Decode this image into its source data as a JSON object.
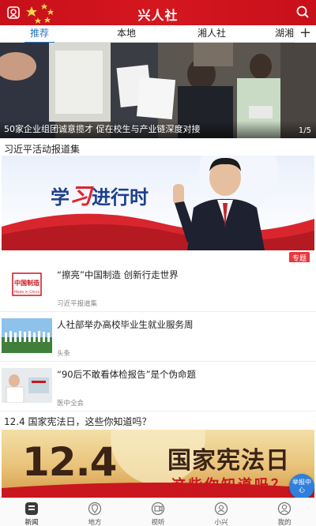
{
  "header": {
    "title": "兴人社"
  },
  "tabs": [
    {
      "label": "推荐",
      "active": true
    },
    {
      "label": "本地"
    },
    {
      "label": "湘人社"
    },
    {
      "label": "湖湘"
    }
  ],
  "tab_add_label": "+",
  "hero": {
    "caption": "50家企业组团诚意揽才 促在校生与产业链深度对接",
    "counter": "1/5"
  },
  "section1": {
    "title": "习近平活动报道集"
  },
  "banner1": {
    "text_study": "学",
    "text_xi": "习",
    "text_rest": "进行时",
    "tag": "专题"
  },
  "news": [
    {
      "title": "“擦亮”中国制造 创新行走世界",
      "source": "习近平报道集",
      "thumb_text": "中国制造",
      "thumb_sub": "Made in China"
    },
    {
      "title": "人社部举办高校毕业生就业服务周",
      "source": "头条"
    },
    {
      "title": "“90后不敢看体检报告”是个伪命题",
      "source": "医中全会"
    }
  ],
  "section2": {
    "title": "12.4  国家宪法日，这些你知道吗？"
  },
  "banner2": {
    "date": "12.4",
    "line1": "国家宪法日",
    "line2": "这些你知道吗？"
  },
  "report_fab": {
    "line1": "举报中",
    "line2": "心"
  },
  "bottom_nav": [
    {
      "label": "新闻",
      "icon": "news-icon",
      "active": true
    },
    {
      "label": "地方",
      "icon": "location-icon"
    },
    {
      "label": "视听",
      "icon": "video-icon"
    },
    {
      "label": "小兴",
      "icon": "assistant-icon"
    },
    {
      "label": "我的",
      "icon": "profile-icon"
    }
  ],
  "colors": {
    "brand_red": "#c8101a",
    "accent_blue": "#2b74c7",
    "tag_red": "#e8383d"
  }
}
